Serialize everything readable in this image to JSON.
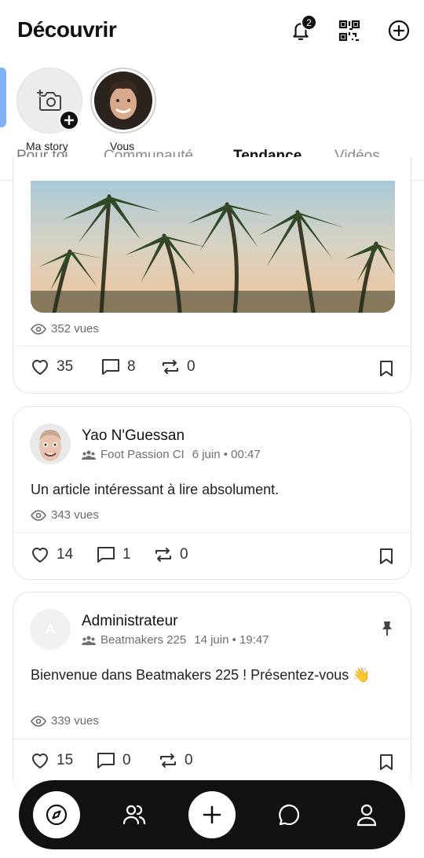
{
  "header": {
    "title": "Découvrir",
    "notification_count": "2"
  },
  "stories": [
    {
      "label": "Ma story"
    },
    {
      "label": "Vous"
    }
  ],
  "tabs": [
    "Pour toi",
    "Communauté",
    "Tendance",
    "Vidéos"
  ],
  "active_tab": "Tendance",
  "posts": [
    {
      "views": "352 vues",
      "likes": "35",
      "comments": "8",
      "reposts": "0"
    },
    {
      "author": "Yao N'Guessan",
      "community": "Foot Passion CI",
      "time": "6 juin • 00:47",
      "text": "Un article intéressant à lire absolument.",
      "views": "343 vues",
      "likes": "14",
      "comments": "1",
      "reposts": "0"
    },
    {
      "author": "Administrateur",
      "avatar_letter": "A",
      "community": "Beatmakers 225",
      "time": "14 juin • 19:47",
      "text": "Bienvenue dans Beatmakers 225 ! Présentez-vous 👋",
      "views": "339 vues",
      "likes": "15",
      "comments": "0",
      "reposts": "0",
      "pinned": true
    }
  ],
  "icons": {
    "bell": "bell-icon",
    "qr": "qr-code-icon",
    "add": "plus-circle-icon",
    "camera": "camera-add-icon",
    "eye": "eye-icon",
    "heart": "heart-icon",
    "comment": "comment-icon",
    "repost": "repost-icon",
    "bookmark": "bookmark-icon",
    "group": "group-icon",
    "pin": "pin-icon",
    "compass": "compass-icon",
    "people": "people-icon",
    "chat": "chat-icon",
    "profile": "profile-icon"
  },
  "colors": {
    "accent": "#111111",
    "story_accent": "#7eb2f5"
  }
}
